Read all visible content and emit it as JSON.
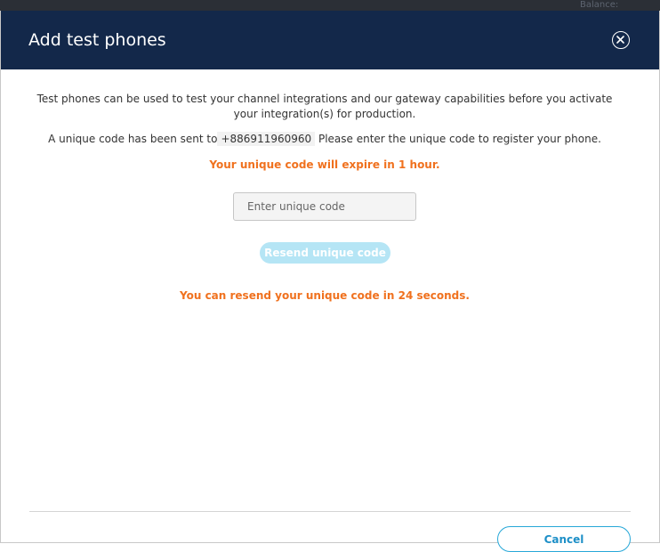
{
  "backdrop": {
    "partial_text": "Balance:"
  },
  "dialog": {
    "title": "Add test phones",
    "close_icon": "close-circle-icon"
  },
  "body": {
    "intro": "Test phones can be used to test your channel integrations and our gateway capabilities before you activate your integration(s) for production.",
    "code_sent_prefix": "A unique code has been sent to",
    "phone_number": "+886911960960",
    "code_sent_suffix": "Please enter the unique code to register your phone.",
    "expiry_notice": "Your unique code will expire in 1 hour.",
    "code_input": {
      "value": "",
      "placeholder": "Enter unique code"
    },
    "resend_label": "Resend unique code",
    "countdown_prefix": "You can resend your unique code in",
    "countdown_seconds": "24",
    "countdown_suffix": "seconds."
  },
  "footer": {
    "cancel_label": "Cancel"
  },
  "colors": {
    "header_bg": "#13284a",
    "warning": "#f0711e",
    "accent": "#28a8d8",
    "resend_disabled": "#b5e5f5"
  }
}
